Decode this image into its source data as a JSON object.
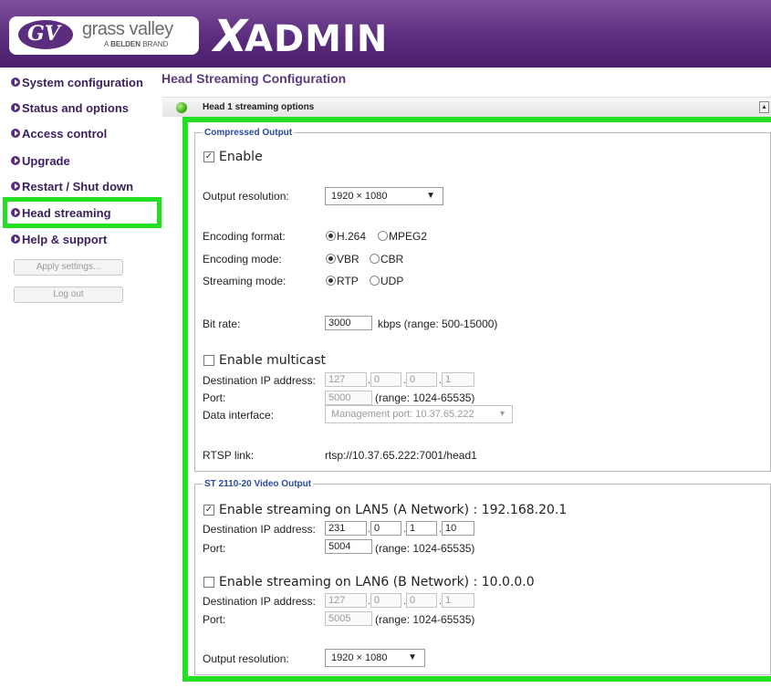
{
  "header": {
    "brand_name": "grass valley",
    "brand_sub_prefix": "A",
    "brand_sub_company": "BELDEN",
    "brand_sub_suffix": "BRAND",
    "product_x": "X",
    "product_rest": "ADMIN"
  },
  "sidebar": {
    "items": [
      {
        "label": "System configuration"
      },
      {
        "label": "Status and options"
      },
      {
        "label": "Access control"
      },
      {
        "label": "Upgrade"
      },
      {
        "label": "Restart / Shut down"
      },
      {
        "label": "Head streaming"
      },
      {
        "label": "Help & support"
      }
    ],
    "apply_button": "Apply settings...",
    "logout_button": "Log out",
    "active_item": "Head streaming"
  },
  "page": {
    "title": "Head Streaming Configuration",
    "section_title": "Head 1 streaming options",
    "status_color": "#3fae1a"
  },
  "compressed": {
    "legend": "Compressed Output",
    "enable_label": "Enable",
    "enable_checked": true,
    "output_resolution_label": "Output resolution:",
    "output_resolution_value": "1920 × 1080",
    "encoding_format_label": "Encoding format:",
    "encoding_format_options": [
      "H.264",
      "MPEG2"
    ],
    "encoding_format_selected": "H.264",
    "encoding_mode_label": "Encoding mode:",
    "encoding_mode_options": [
      "VBR",
      "CBR"
    ],
    "encoding_mode_selected": "VBR",
    "streaming_mode_label": "Streaming mode:",
    "streaming_mode_options": [
      "RTP",
      "UDP"
    ],
    "streaming_mode_selected": "RTP",
    "bit_rate_label": "Bit rate:",
    "bit_rate_value": "3000",
    "bit_rate_hint": "kbps (range: 500-15000)",
    "multicast_label": "Enable multicast",
    "multicast_checked": false,
    "dest_ip_label": "Destination IP address:",
    "dest_ip": [
      "127",
      "0",
      "0",
      "1"
    ],
    "port_label": "Port:",
    "port_value": "5000",
    "port_hint": "(range: 1024-65535)",
    "data_interface_label": "Data interface:",
    "data_interface_value": "Management port: 10.37.65.222",
    "rtsp_label": "RTSP link:",
    "rtsp_value": "rtsp://10.37.65.222:7001/head1"
  },
  "st2110": {
    "legend": "ST 2110-20 Video Output",
    "lan5_label": "Enable streaming on LAN5 (A Network) : 192.168.20.1",
    "lan5_checked": true,
    "lan5_dest_ip_label": "Destination IP address:",
    "lan5_dest_ip": [
      "231",
      "0",
      "1",
      "10"
    ],
    "lan5_port_label": "Port:",
    "lan5_port_value": "5004",
    "lan5_port_hint": "(range: 1024-65535)",
    "lan6_label": "Enable streaming on LAN6 (B Network) : 10.0.0.0",
    "lan6_checked": false,
    "lan6_dest_ip_label": "Destination IP address:",
    "lan6_dest_ip": [
      "127",
      "0",
      "0",
      "1"
    ],
    "lan6_port_label": "Port:",
    "lan6_port_value": "5005",
    "lan6_port_hint": "(range: 1024-65535)",
    "output_resolution_label": "Output resolution:",
    "output_resolution_value": "1920 × 1080"
  },
  "colors": {
    "header_purple": "#5b2d7e",
    "highlight_green": "#22e022",
    "nav_text": "#3a1f5c",
    "legend_blue": "#2a4a9a"
  }
}
